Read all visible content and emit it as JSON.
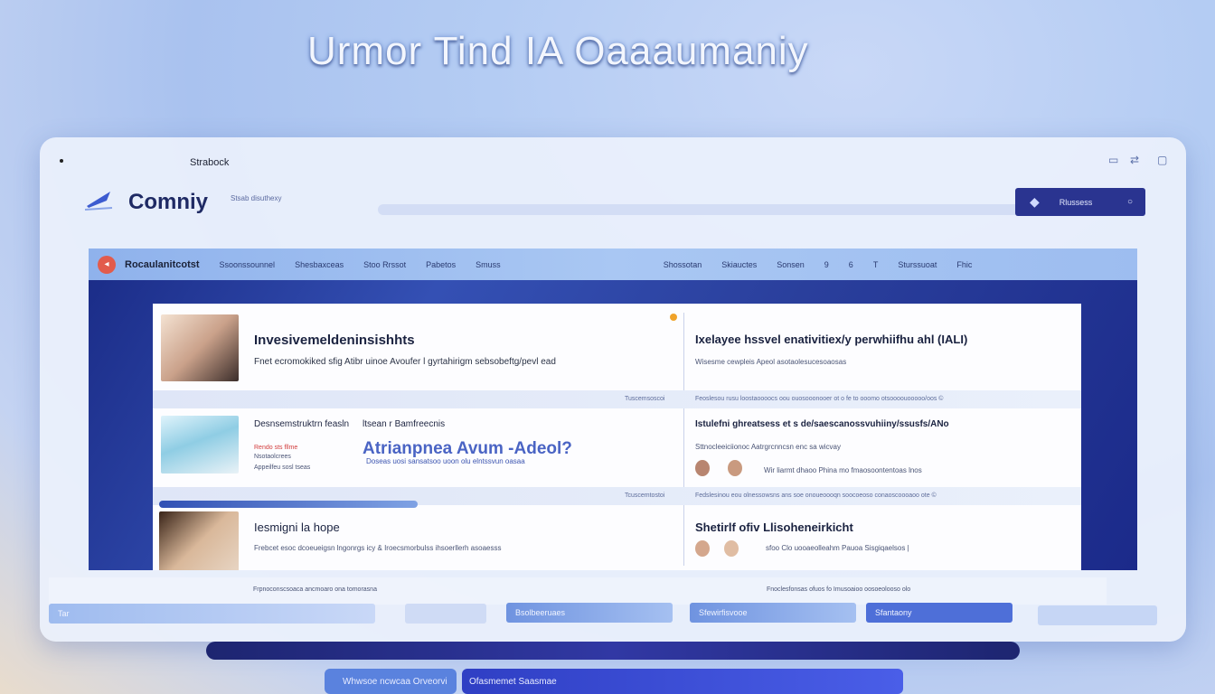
{
  "hero": {
    "title": "Urmor Tind IA Oaaaumaniy"
  },
  "window": {
    "title": "Strabock",
    "controls": [
      "▭",
      "⇄",
      "▢"
    ],
    "logo_text": "Comniy",
    "tagline": "Stsab disuthexy",
    "search_button_label": "Rlussess",
    "search_button_icon": "megaphone-icon"
  },
  "nav": {
    "brand": "Rocaulanitcotst",
    "items": [
      "Ssoonssounnel",
      "Shesbaxceas",
      "Stoo Rrssot",
      "Pabetos",
      "Smuss",
      "Shossotan",
      "Skiauctes",
      "Sonsen",
      "9",
      "6",
      "T",
      "Sturssuoat",
      "Fhic"
    ]
  },
  "cards": {
    "left": [
      {
        "title": "Invesivemeldeninsishhts",
        "subtitle": "Fnet  ecromokiked  sfig Atibr uinoe  Avoufer l gyrtahirigm  sebsobeftg/pevl  ead",
        "meta": "Tuscemsoscoi"
      },
      {
        "title": "Desnsemstruktrn  feasln",
        "aside": "ltsean r Bamfreecnis",
        "lines": [
          "Rendo sts fllme",
          "Nsotaolcrees",
          "Appeilfeu sosl tseas"
        ],
        "highlight": "Atrianpnea  Avum -Adeol?",
        "highlight_sub": "Doseas uosi sansatsoo uoon olu elntssvun oasaa",
        "meta": "Tcuscemtostoi"
      },
      {
        "title": "Iesmigni la hope",
        "subtitle": "Frebcet esoc dcoeueigsn lngonrgs icy &  Iroecsmorbulss ihsoerllerh  asoaesss",
        "meta": "Frpnoconscsoaca ancmoaro ona tomorasna"
      }
    ],
    "right": [
      {
        "title": "Ixelayee hssvel enativitiex/y perwhiifhu ahl (IALI)",
        "subtitle": "Wisesme cewpleis  Apeol asotaolesucesoaosas",
        "meta": "Feoslesou rusu  loostaoooocs oou ouosooonooer ot o fe to ooomo otsoooouooooo/oos  ©"
      },
      {
        "title": "Istulefni ghreatsess et s de/saescanossvuhiiny/ssusfs/ANo",
        "subtitle": "Sttnocleeiciionoc  Aatrgrcnncsn enc sa  wicvay",
        "line": "Wir liarmt dhaoo  Phina  mo fmaosoontentoas lnos",
        "meta": "Fedslesinou eou olnessowsns ans soe onoueoooqn soocoeoso conaoscoooaoo ote  ©"
      },
      {
        "title": "Shetirlf ofiv Llisoheneirkicht",
        "subtitle": "sfoo Clo uooaeolleahm Pauoa  Sisgiqaelsos  |",
        "meta": "Fnoclesfonsas ofuos fo  Imusoaioo oosoeolooso olo"
      }
    ]
  },
  "bottom": {
    "pill_left": "Tar",
    "pill_a": "Bsolbeeruaes",
    "pill_b": "Sfewirfisvooe",
    "pill_c": "Sfantaony"
  },
  "footer": {
    "btn_a": "Whwsoe ncwcaa Orveorvi",
    "btn_b": "Ofasmemet Saasmae"
  },
  "colors": {
    "accent": "#2a3490",
    "panel": "#2a3f9c",
    "highlight": "#4a64c4",
    "alert": "#d23c3c"
  }
}
